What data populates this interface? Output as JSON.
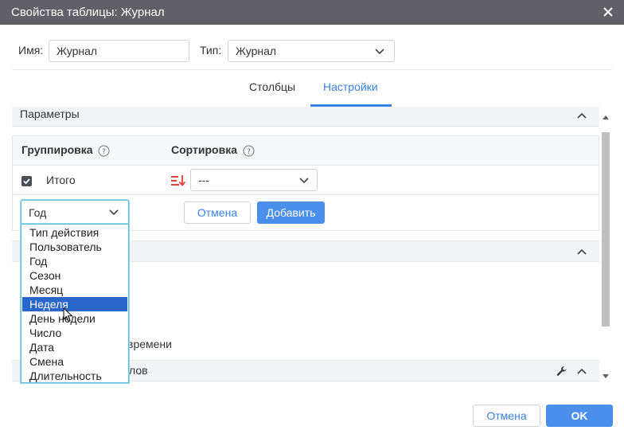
{
  "dialog": {
    "title": "Свойства таблицы: Журнал"
  },
  "form": {
    "name_label": "Имя:",
    "name_value": "Журнал",
    "type_label": "Тип:",
    "type_value": "Журнал"
  },
  "tabs": [
    {
      "label": "Столбцы",
      "active": false
    },
    {
      "label": "Настройки",
      "active": true
    }
  ],
  "params_section": {
    "title": "Параметры"
  },
  "grouping": {
    "group_header": "Группировка",
    "sort_header": "Сортировка",
    "row_total_label": "Итого",
    "row_total_checked": true,
    "sort_value": "---",
    "group_select_value": "Год",
    "cancel_label": "Отмена",
    "add_label": "Добавить"
  },
  "dropdown_options": [
    "Тип действия",
    "Пользователь",
    "Год",
    "Сезон",
    "Месяц",
    "Неделя",
    "День недели",
    "Число",
    "Дата",
    "Смена",
    "Длительность"
  ],
  "dropdown_highlighted": "Неделя",
  "partial_text": {
    "time_fragment": "времени",
    "section3_fragment": "лов"
  },
  "footer": {
    "cancel_label": "Отмена",
    "ok_label": "OK"
  },
  "colors": {
    "accent": "#3b82e8",
    "titlebar": "#606066",
    "highlight": "#2a66c9",
    "sort_icon": "#e0433a"
  }
}
